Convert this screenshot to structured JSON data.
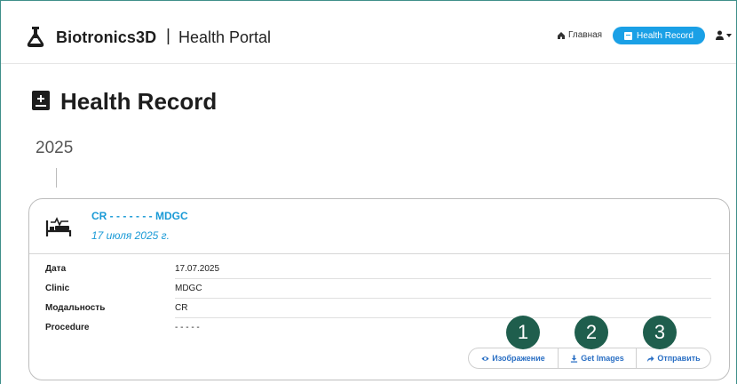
{
  "header": {
    "brand": "Biotronics3D",
    "separator": "|",
    "subtitle": "Health Portal",
    "nav_home": "Главная",
    "nav_active": "Health Record"
  },
  "page": {
    "title": "Health Record",
    "year": "2025"
  },
  "record": {
    "title": "CR - - - - - - - MDGC",
    "date": "17 июля 2025 г.",
    "fields": [
      {
        "label": "Дата",
        "value": "17.07.2025"
      },
      {
        "label": "Clinic",
        "value": "MDGC"
      },
      {
        "label": "Модальность",
        "value": "CR"
      },
      {
        "label": "Procedure",
        "value": "- - - - -"
      }
    ],
    "actions": {
      "view": "Изображение",
      "download": "Get Images",
      "send": "Отправить"
    }
  },
  "annotations": [
    "1",
    "2",
    "3"
  ],
  "colors": {
    "accent": "#1aa0e6",
    "link": "#1a9ad6",
    "badge": "#1f5e4d"
  }
}
